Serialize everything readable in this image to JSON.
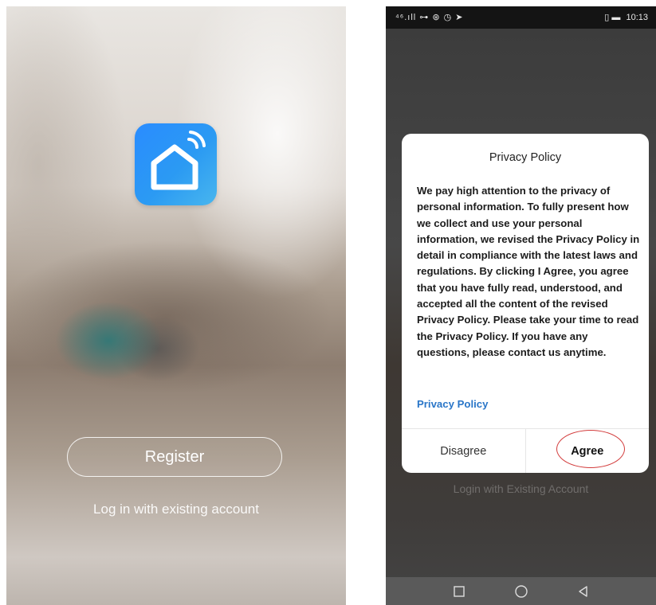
{
  "left_screen": {
    "register_label": "Register",
    "login_link": "Log in with existing account"
  },
  "right_screen": {
    "status_bar": {
      "left_icons_text": "⁴⁶.ıll ⊶ ⊛ ◷ ➤",
      "right_icons_text": "▯ ▬",
      "time": "10:13"
    },
    "background_link": "Login with Existing Account",
    "dialog": {
      "title": "Privacy Policy",
      "body": "We pay high attention to the privacy of personal information. To fully present how we collect and use your personal information, we revised the Privacy Policy in detail in compliance with the latest laws and regulations. By clicking I Agree, you agree that you have fully read, understood, and accepted all the content of the revised Privacy Policy. Please take your time to read the Privacy Policy. If you have any questions, please contact us anytime.",
      "link": "Privacy Policy",
      "disagree_label": "Disagree",
      "agree_label": "Agree"
    }
  },
  "colors": {
    "app_icon_blue": "#2b9af3",
    "link_blue": "#2a76c8",
    "annotation_red": "#d23a3a"
  }
}
